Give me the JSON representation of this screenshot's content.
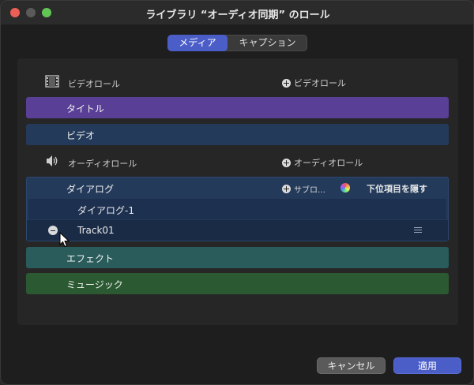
{
  "window": {
    "title": "ライブラリ “オーディオ同期” のロール"
  },
  "tabs": [
    {
      "label": "メディア",
      "selected": true
    },
    {
      "label": "キャプション",
      "selected": false
    }
  ],
  "video_section": {
    "label": "ビデオロール",
    "add_label": "ビデオロール",
    "icon": "film-icon"
  },
  "video_roles": [
    {
      "label": "タイトル",
      "color": "#5a3f96"
    },
    {
      "label": "ビデオ",
      "color": "#233a5a"
    }
  ],
  "audio_section": {
    "label": "オーディオロール",
    "add_label": "オーディオロール",
    "icon": "speaker-icon"
  },
  "dialogue_role": {
    "label": "ダイアログ",
    "add_subrole_label": "サブロ…",
    "hide_subroles_label": "下位項目を隠す",
    "color": "#233a5a",
    "subroles": [
      {
        "label": "ダイアログ-1"
      }
    ],
    "track": {
      "label": "Track01"
    }
  },
  "audio_roles": [
    {
      "label": "エフェクト",
      "color": "#2a5c5c"
    },
    {
      "label": "ミュージック",
      "color": "#2b5a32"
    }
  ],
  "footer": {
    "cancel_label": "キャンセル",
    "apply_label": "適用"
  },
  "colors": {
    "accent": "#4b5ec8",
    "window_bg": "#1e1e1e"
  }
}
